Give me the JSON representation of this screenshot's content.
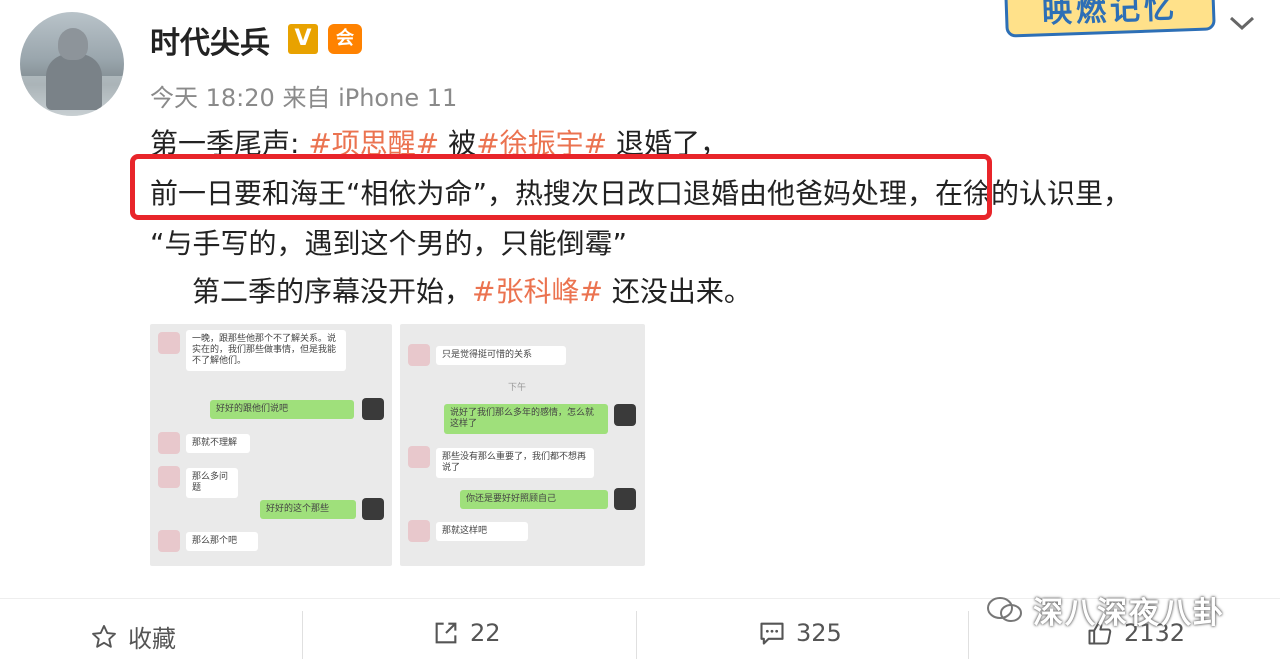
{
  "header": {
    "username": "时代尖兵",
    "verified_badge": "V",
    "vip_badge": "会",
    "timestamp": "今天 18:20",
    "source_prefix": "来自",
    "device": "iPhone 11",
    "banner_text": "映燃记忆"
  },
  "post": {
    "line1": {
      "prefix": "第一季尾声: ",
      "tag1": "#项思醒#",
      "mid": " 被",
      "tag2": "#徐振宇#",
      "suffix": " 退婚了，"
    },
    "line2": {
      "highlight": "前一日要和海王“相依为命”，热搜次日改口退婚由他爸妈处理，",
      "after": "在徐的认识里，"
    },
    "line3": "“与手写的，遇到这个男的，只能倒霉”",
    "line4": {
      "prefix": "第二季的序幕没开始，",
      "tag": "#张科峰#",
      "suffix": " 还没出来。"
    }
  },
  "images": {
    "chat1": [
      "一晚，跟那些他那个不了解关系。说实在的，我们那些做事情，但是我能不了解他们。",
      "好好的跟他们说吧",
      "那就不理解",
      "那么多问题",
      "好好的这个那些",
      "那么那个吧"
    ],
    "chat2": [
      "只是觉得挺可惜的关系",
      "下午",
      "说好了我们那么多年的感情，怎么就这样了",
      "那些没有那么重要了，我们都不想再说了",
      "你还是要好好照顾自己",
      "那就这样吧"
    ]
  },
  "actions": {
    "favorite_label": "收藏",
    "share_count": "22",
    "comment_count": "325",
    "like_count": "2132"
  },
  "watermark": "深八深夜八卦",
  "colors": {
    "tag": "#eb7350",
    "highlight_border": "#e8252a",
    "wechat_green": "#9fe07b"
  }
}
